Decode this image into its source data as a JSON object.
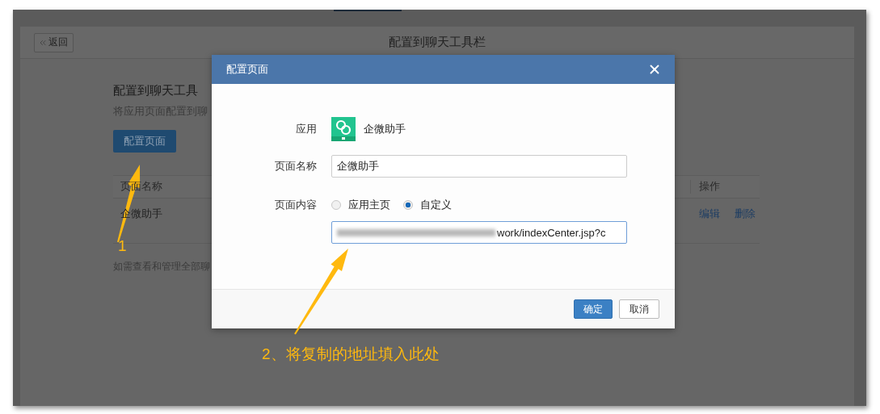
{
  "page": {
    "back_button": "返回",
    "title": "配置到聊天工具栏",
    "heading": "配置到聊天工具",
    "description": "将应用页面配置到聊",
    "config_button": "配置页面",
    "table": {
      "columns": [
        "页面名称",
        "操作"
      ],
      "rows": [
        {
          "name": "企微助手",
          "actions": [
            "编辑",
            "删除"
          ]
        }
      ]
    },
    "footer_note": "如需查看和管理全部聊"
  },
  "dialog": {
    "title": "配置页面",
    "app_label": "应用",
    "app_name": "企微助手",
    "name_label": "页面名称",
    "name_value": "企微助手",
    "content_label": "页面内容",
    "content_options": [
      {
        "label": "应用主页",
        "selected": false
      },
      {
        "label": "自定义",
        "selected": true
      }
    ],
    "url_value": "work/indexCenter.jsp?c",
    "confirm_button": "确定",
    "cancel_button": "取消"
  },
  "annotations": [
    {
      "text": "1"
    },
    {
      "text": "2、将复制的地址填入此处"
    }
  ]
}
